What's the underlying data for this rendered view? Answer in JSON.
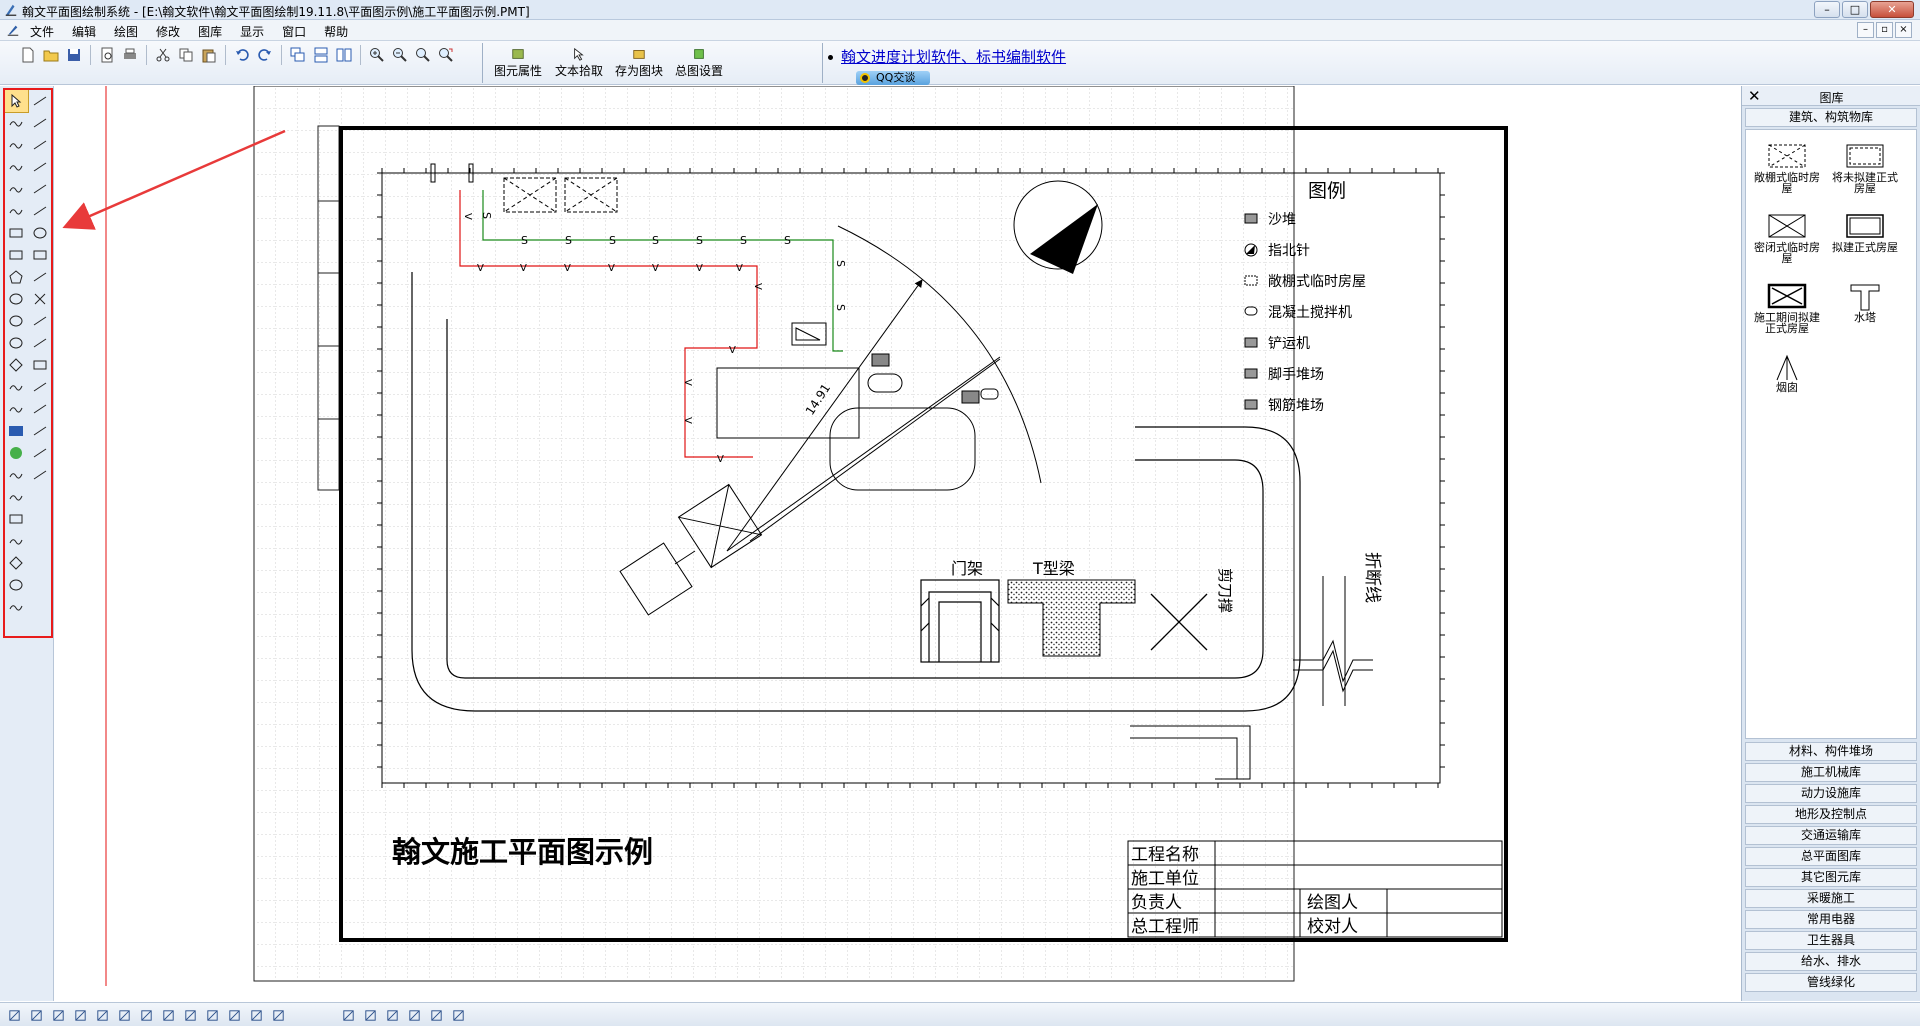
{
  "window": {
    "title": "翰文平面图绘制系统 - [E:\\翰文软件\\翰文平面图绘制19.11.8\\平面图示例\\施工平面图示例.PMT]",
    "buttons": [
      "–",
      "□",
      "✕"
    ]
  },
  "menubar": {
    "items": [
      "文件",
      "编辑",
      "绘图",
      "修改",
      "图库",
      "显示",
      "窗口",
      "帮助"
    ],
    "mdi_buttons": [
      "–",
      "▫",
      "×"
    ]
  },
  "toolbar": {
    "text_buttons": [
      "图元属性",
      "文本拾取",
      "存为图块",
      "总图设置"
    ],
    "promo_link": "翰文进度计划软件、标书编制软件",
    "qq_button": "QQ交谈"
  },
  "drawing": {
    "title": "翰文施工平面图示例",
    "legend_title": "图例",
    "legend_items": [
      "沙堆",
      "指北针",
      "敞棚式临时房屋",
      "混凝土搅拌机",
      "铲运机",
      "脚手堆场",
      "钢筋堆场"
    ],
    "labels": {
      "gantry": "门架",
      "tbeam": "T型梁",
      "scissor": "剪刀撑",
      "breakline": "折断线",
      "dimension": "14.91",
      "water_line_mark": "S",
      "power_line_mark": "V"
    },
    "title_block": {
      "project_name": "工程名称",
      "construction_unit": "施工单位",
      "person_in_charge": "负责人",
      "drawer": "绘图人",
      "chief_engineer": "总工程师",
      "checker": "校对人"
    },
    "colors": {
      "power_line": "#e01414",
      "water_line": "#1a8a1a",
      "annotation_arrow": "#e83a3a",
      "guide_line": "#e83a3a"
    }
  },
  "library": {
    "title": "图库",
    "active_category": "建筑、构筑物库",
    "items": [
      {
        "label": "敞棚式临时房屋",
        "icon": "open-shed-icon"
      },
      {
        "label": "将未拟建正式房屋",
        "icon": "planned-building-icon"
      },
      {
        "label": "密闭式临时房屋",
        "icon": "closed-temp-house-icon"
      },
      {
        "label": "拟建正式房屋",
        "icon": "proposed-building-icon"
      },
      {
        "label": "施工期间拟建正式房屋",
        "icon": "construction-building-icon"
      },
      {
        "label": "水塔",
        "icon": "water-tower-icon"
      },
      {
        "label": "烟囱",
        "icon": "chimney-icon"
      }
    ],
    "categories": [
      "材料、构件堆场",
      "施工机械库",
      "动力设施库",
      "地形及控制点",
      "交通运输库",
      "总平面图库",
      "其它图元库",
      "采暖施工",
      "常用电器",
      "卫生器具",
      "给水、排水",
      "管线绿化"
    ]
  }
}
